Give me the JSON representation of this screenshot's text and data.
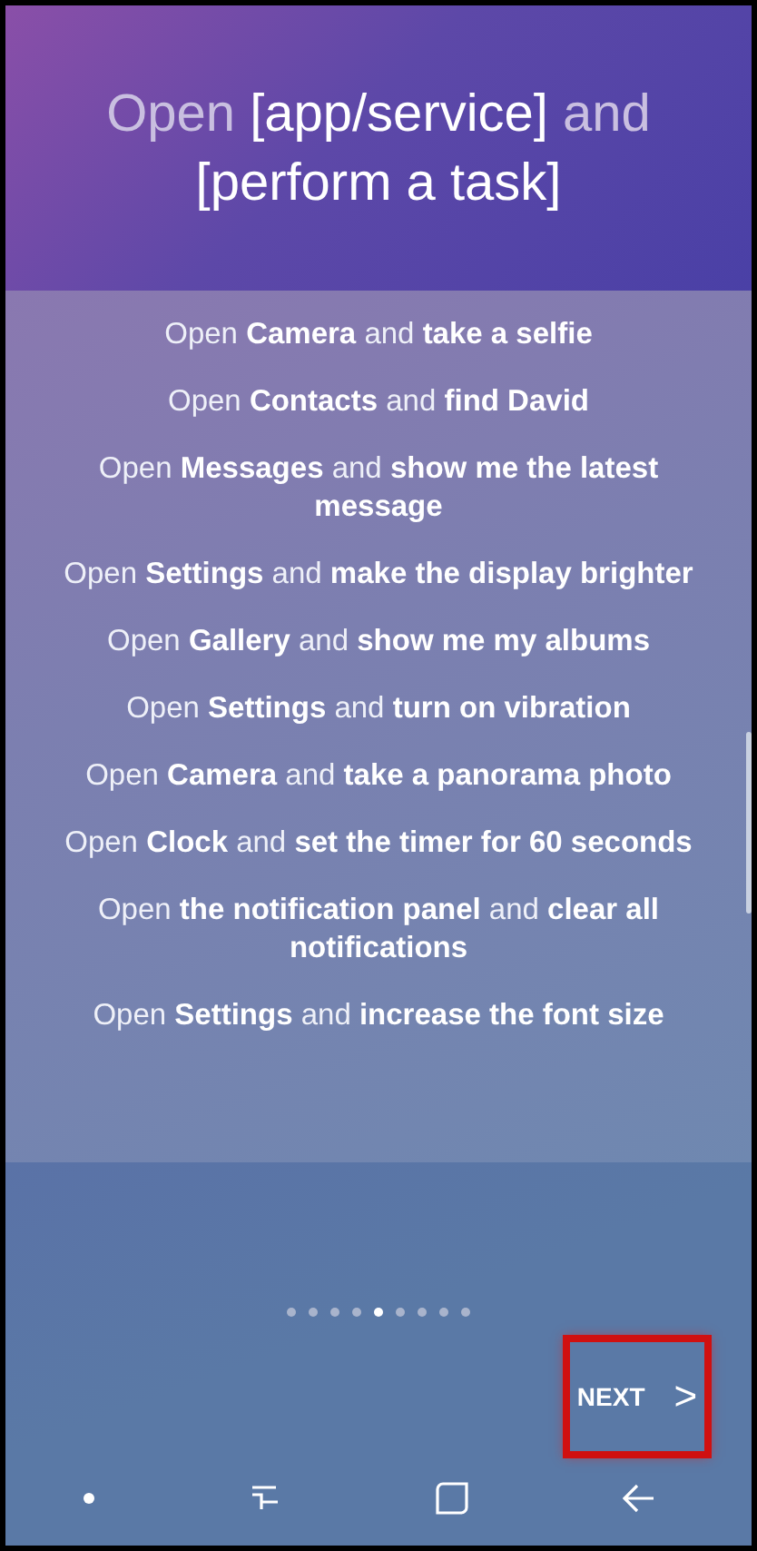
{
  "title": {
    "parts": [
      {
        "text": "Open ",
        "emphasis": false
      },
      {
        "text": "[app/service]",
        "emphasis": true
      },
      {
        "text": " and ",
        "emphasis": false
      },
      {
        "text": "[perform a task]",
        "emphasis": true
      }
    ]
  },
  "examples": [
    "Open **Camera** and **take a selfie**",
    "Open **Contacts** and **find David**",
    "Open **Messages** and **show me the latest message**",
    "Open **Settings** and **make the display brighter**",
    "Open **Gallery** and **show me my albums**",
    "Open **Settings** and **turn on vibration**",
    "Open **Camera** and **take a panorama photo**",
    "Open **Clock** and **set the timer for 60 seconds**",
    "Open **the notification panel** and **clear all notifications**",
    "Open **Settings** and **increase the font size**"
  ],
  "pager": [
    {
      "selected": false
    },
    {
      "selected": false
    },
    {
      "selected": false
    },
    {
      "selected": false
    },
    {
      "selected": true
    },
    {
      "selected": false
    },
    {
      "selected": false
    },
    {
      "selected": false
    },
    {
      "selected": false
    }
  ],
  "next_button": {
    "label": "NEXT",
    "icon": ">",
    "highlighted": true
  },
  "nav_bar": [
    {
      "kind": "dot"
    },
    {
      "kind": "recent"
    },
    {
      "kind": "home"
    },
    {
      "kind": "back"
    }
  ]
}
